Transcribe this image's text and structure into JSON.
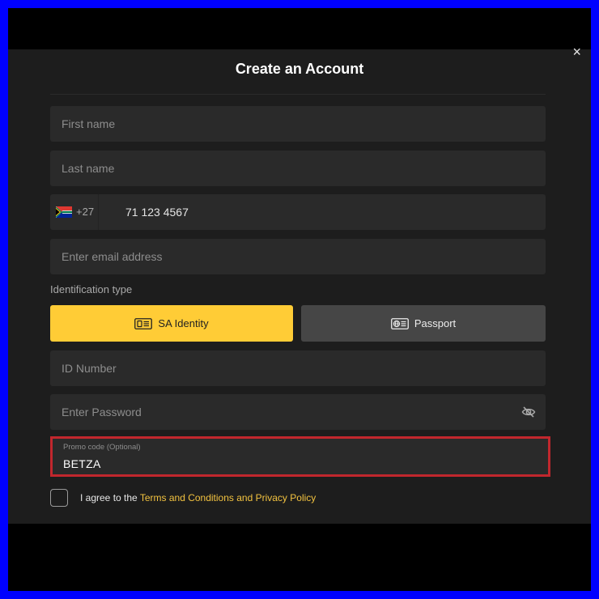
{
  "modal": {
    "title": "Create an Account",
    "close_glyph": "×"
  },
  "form": {
    "first_name_placeholder": "First name",
    "last_name_placeholder": "Last name",
    "phone": {
      "country_flag": "south-africa-flag-icon",
      "dial_code": "+27",
      "value": "71 123 4567"
    },
    "email_placeholder": "Enter email address",
    "identification": {
      "label": "Identification type",
      "options": [
        {
          "label": "SA Identity",
          "icon": "id-card-icon",
          "selected": true
        },
        {
          "label": "Passport",
          "icon": "passport-icon",
          "selected": false
        }
      ]
    },
    "id_number_placeholder": "ID Number",
    "password_placeholder": "Enter Password",
    "password_toggle_icon": "eye-off-icon",
    "promo": {
      "label": "Promo code (Optional)",
      "value": "BETZA"
    },
    "agree": {
      "prefix": "I agree to the ",
      "link": "Terms and Conditions and Privacy Policy"
    }
  },
  "colors": {
    "frame": "#0000ff",
    "modal_bg": "#1d1d1d",
    "field_bg": "#2a2a2a",
    "accent": "#ffcc36",
    "highlight_border": "#c1272d",
    "link": "#f3c340"
  }
}
